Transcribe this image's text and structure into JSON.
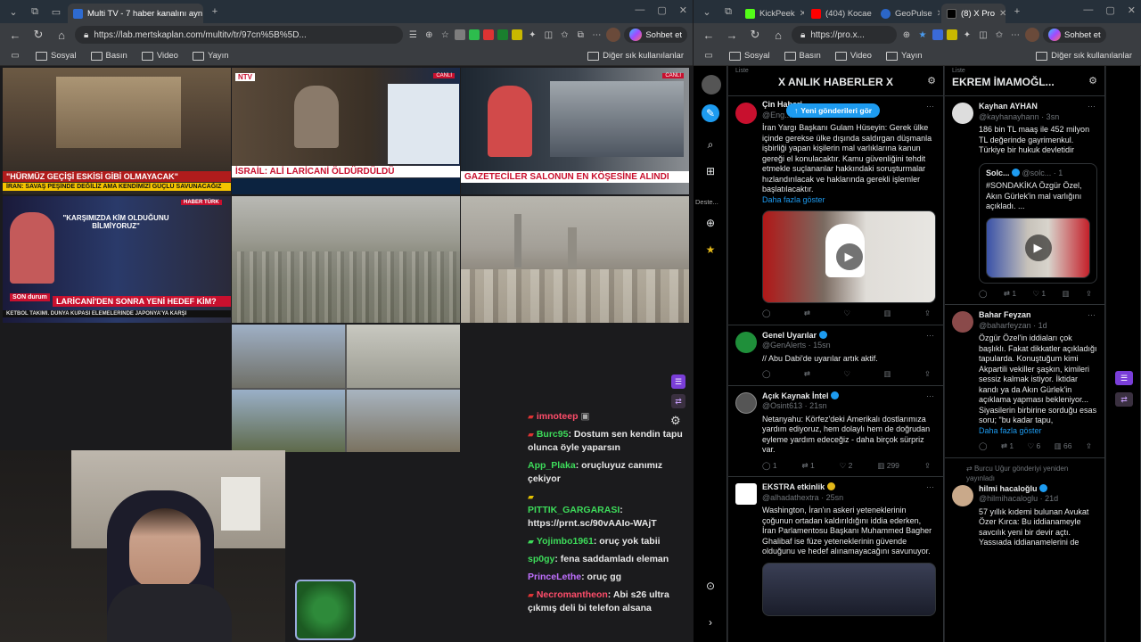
{
  "left_window": {
    "tabs": [
      {
        "label": "Multi TV - 7 haber kanalını aynı an",
        "active": true
      }
    ],
    "url": "https://lab.mertskaplan.com/multitv/tr/97cn%5B%5D...",
    "chat_button": "Sohbet et",
    "bookmarks": [
      "Sosyal",
      "Basın",
      "Video",
      "Yayın"
    ],
    "bookmarks_other": "Diğer sık kullanılanlar",
    "tiles": {
      "t1_ticker": "\"HÜRMÜZ GEÇİŞİ ESKİSİ GİBİ OLMAYACAK\"",
      "t1_sub": "İRAN: SAVAŞ PEŞİNDE DEĞİLİZ AMA KENDİMİZİ GÜÇLÜ SAVUNACAĞIZ",
      "t2_ticker": "İSRAİL: ALİ LARİCANİ ÖLDÜRDÜLDÜ",
      "t2_logo": "NTV",
      "t2_live": "CANLI",
      "t3_ticker": "GAZETECİLER SALONUN EN KÖŞESİNE ALINDI",
      "t3_live": "CANLI",
      "t4_quote": "\"KARŞIMIZDA KİM OLDUĞUNU BİLMİYORUZ\"",
      "t4_ticker": "LARİCANİ'DEN SONRA YENİ HEDEF KİM?",
      "t4_sub": "KETBOL TAKIMI. DÜNYA KUPASI ELEMELERİNDE JAPONYA'YA KARŞI",
      "t4_logo": "SON durum",
      "t4_brand": "HABER TÜRK"
    },
    "chat": [
      {
        "user": "imnoteep",
        "text": "",
        "color": "#ff4d6a"
      },
      {
        "user": "Burc95",
        "text": "Dostum sen kendin tapu olunca öyle yaparsın",
        "color": "#3ddc5a"
      },
      {
        "user": "App_Plaka",
        "text": "oruçluyuz canımız çekiyor",
        "color": "#3ddc5a"
      },
      {
        "user": "PITTIK_GARGARASI",
        "text": "https://prnt.sc/90vAAIo-WAjT",
        "color": "#3ddc5a"
      },
      {
        "user": "Yojimbo1961",
        "text": "oruç yok tabii",
        "color": "#3ddc5a"
      },
      {
        "user": "sp0gy",
        "text": "fena saddamladı eleman",
        "color": "#3ddc5a"
      },
      {
        "user": "PrinceLethe",
        "text": "oruç gg",
        "color": "#c070ff"
      },
      {
        "user": "Necromantheon",
        "text": "Abi s26 ultra çıkmış deli bi telefon alsana",
        "color": "#ff4d6a"
      }
    ]
  },
  "right_window": {
    "tabs": [
      {
        "label": "KickPeek",
        "active": false
      },
      {
        "label": "(404) Kocae",
        "active": false
      },
      {
        "label": "GeoPulse",
        "active": false
      },
      {
        "label": "(8) X Pro",
        "active": true
      }
    ],
    "url": "https://pro.x...",
    "chat_button": "Sohbet et",
    "bookmarks": [
      "Sosyal",
      "Basın",
      "Video",
      "Yayın"
    ],
    "bookmarks_other": "Diğer sık kullanılanlar",
    "rail_label": "Deste...",
    "col1": {
      "label": "Liste",
      "title": "X ANLIK HABERLER X",
      "new_posts": "Yeni gönderileri gör",
      "tweets": [
        {
          "name": "Çin Haberi",
          "handle": "@Eng...",
          "text": "İran Yargı Başkanı Gulam Hüseyin: Gerek ülke içinde gerekse ülke dışında saldırgan düşmanla işbirliği yapan kişilerin mal varlıklarına kanun gereği el konulacaktır. Kamu güvenliğini tehdit etmekle suçlananlar hakkındaki soruşturmalar hızlandırılacak ve haklarında gerekli işlemler başlatılacaktır.",
          "more": "Daha fazla göster",
          "actions": [
            "",
            "",
            "",
            "",
            ""
          ]
        },
        {
          "name": "Genel Uyarılar",
          "handle": "@GenAlerts · 15sn",
          "text": "// Abu Dabi'de uyarılar artık aktif.",
          "actions": [
            "",
            "",
            "",
            "",
            ""
          ]
        },
        {
          "name": "Açık Kaynak İntel",
          "handle": "@Osint613 · 21sn",
          "text": "Netanyahu: Körfez'deki Amerikalı dostlarımıza yardım ediyoruz, hem dolaylı hem de doğrudan eyleme yardım edeceğiz - daha birçok sürpriz var.",
          "actions": [
            "1",
            "1",
            "2",
            "299",
            ""
          ]
        },
        {
          "name": "EKSTRA etkinlik",
          "handle": "@alhadathextra · 25sn",
          "text": "Washington, İran'ın askeri yeteneklerinin çoğunun ortadan kaldırıldığını iddia ederken, İran Parlamentosu Başkanı Muhammed Bagher Ghalibaf ise füze yeteneklerinin güvende olduğunu ve hedef alınamayacağını savunuyor."
        }
      ]
    },
    "col2": {
      "label": "Liste",
      "title": "EKREM İMAMOĞL...",
      "tweets": [
        {
          "name": "Kayhan AYHAN",
          "handle": "@kayhanayhann · 3sn",
          "text": "186 bin TL maaş ile 452 milyon TL değerinde gayrimenkul. Türkiye bir hukuk devletidir",
          "quote_name": "Solc...",
          "quote_handle": "@solc... · 1",
          "quote_text": "#SONDAKİKA Özgür Özel, Akın Gürlek'in mal varlığını açıkladı. ...",
          "actions": [
            "",
            "1",
            "1",
            "",
            ""
          ]
        },
        {
          "name": "Bahar Feyzan",
          "handle": "@baharfeyzan · 1d",
          "text": "Özgür Özel'in iddiaları çok başlıklı. Fakat dikkatler açıkladığı tapularda. Konuştuğum kimi Akpartili vekiller şaşkın, kimileri sessiz kalmak istiyor. İktidar kandı ya da Akın Gürlek'in açıklama yapması bekleniyor... Siyasilerin birbirine sorduğu esas soru; \"bu kadar tapu,",
          "more": "Daha fazla göster",
          "actions": [
            "",
            "1",
            "6",
            "66",
            ""
          ]
        },
        {
          "repost": "Burcu Uğur gönderiyi yeniden yayınladı",
          "name": "hilmi hacaloğlu",
          "handle": "@hilmihacaloglu · 21d",
          "text": "57 yıllık kıdemi bulunan Avukat Özer Kırca: Bu iddianameyle savcılık yeni bir devir açtı. Yassıada iddianamelerini de"
        }
      ]
    }
  },
  "colors": {
    "accent": "#1d9bf0",
    "breaking_red": "#c8102e",
    "ticker_yellow": "#f5c400"
  }
}
